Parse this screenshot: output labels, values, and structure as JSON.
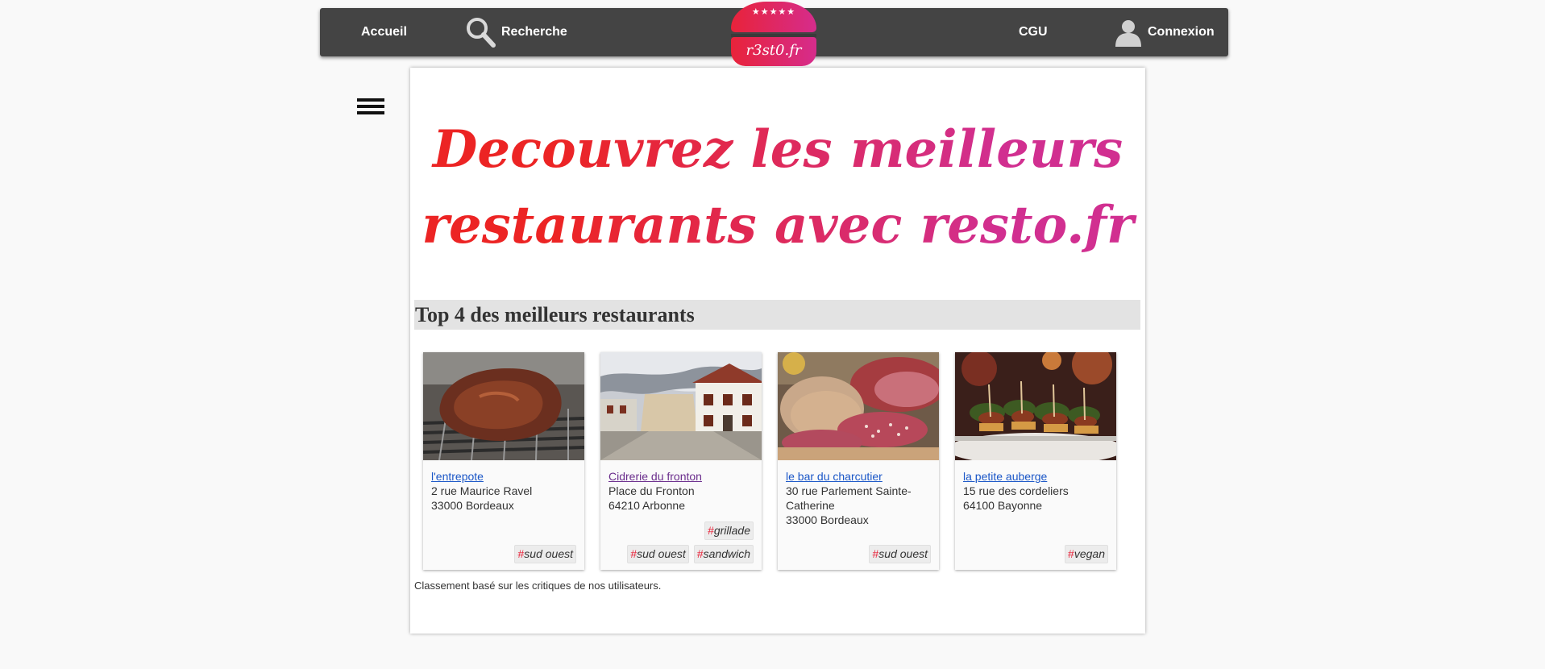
{
  "nav": {
    "home": "Accueil",
    "search": "Recherche",
    "cgu": "CGU",
    "login": "Connexion",
    "logo_stars": "★★★★★",
    "logo_text": "r3st0.fr"
  },
  "hero": {
    "line1": "Decouvrez les meilleurs",
    "line2": "restaurants avec resto.fr"
  },
  "section_title": "Top 4 des meilleurs restaurants",
  "restaurants": [
    {
      "name": "l'entrepote",
      "address1": "2 rue Maurice Ravel",
      "address2": "33000 Bordeaux",
      "address3": "",
      "tags": [
        "sud ouest"
      ],
      "photo_icon": "grilled-steak-photo"
    },
    {
      "name": "Cidrerie du fronton",
      "address1": "Place du Fronton",
      "address2": "64210 Arbonne",
      "address3": "",
      "tags": [
        "sud ouest",
        "sandwich",
        "grillade"
      ],
      "photo_icon": "basque-house-photo"
    },
    {
      "name": "le bar du charcutier",
      "address1": "30 rue Parlement Sainte-Catherine",
      "address2": "33000 Bordeaux",
      "address3": "",
      "tags": [
        "sud ouest"
      ],
      "photo_icon": "saucisson-photo"
    },
    {
      "name": "la petite auberge",
      "address1": "15 rue des cordeliers",
      "address2": "64100 Bayonne",
      "address3": "",
      "tags": [
        "vegan"
      ],
      "photo_icon": "tapas-photo"
    }
  ],
  "tag_hash": "#",
  "footnote": "Classement basé sur les critiques de nos utilisateurs.",
  "colors": {
    "brand_red": "#e8233a",
    "brand_pink": "#d62c8c",
    "nav_bg": "#444444",
    "link": "#1a56c7"
  }
}
